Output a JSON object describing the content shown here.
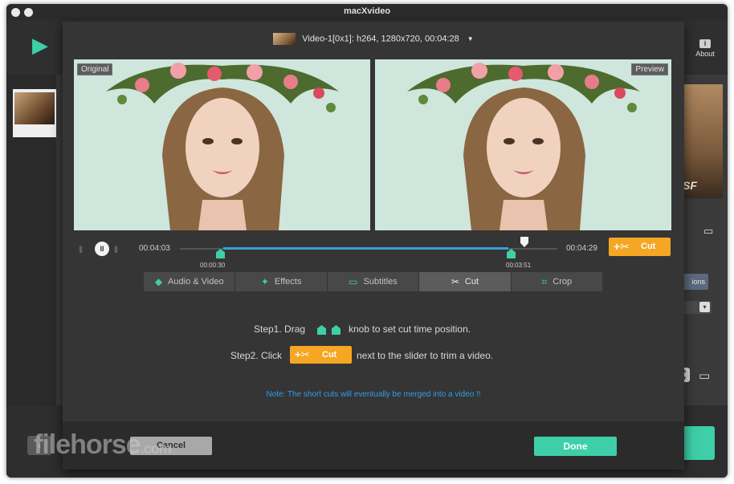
{
  "window": {
    "title": "macXvideo"
  },
  "background_app": {
    "about_label": "About",
    "options_label": "ions",
    "right_thumb_text": "SF"
  },
  "dialog": {
    "video_info": "Video-1[0x1]: h264, 1280x720, 00:04:28",
    "original_label": "Original",
    "preview_label": "Preview",
    "timeline": {
      "current_time": "00:04:03",
      "end_time": "00:04:29",
      "start_knob_time": "00:00:30",
      "end_knob_time": "00:03:51",
      "pause_glyph": "II",
      "start_knob_value": "00:00:30",
      "end_knob_value": "00:03:51",
      "playhead_value": "00:04:03"
    },
    "cut_button_label": "Cut",
    "tabs": [
      {
        "label": "Audio & Video",
        "icon": "audio-video-icon",
        "glyph": "◆"
      },
      {
        "label": "Effects",
        "icon": "effects-wand-icon",
        "glyph": "✦"
      },
      {
        "label": "Subtitles",
        "icon": "subtitles-icon",
        "glyph": "▭"
      },
      {
        "label": "Cut",
        "icon": "scissors-icon",
        "glyph": "✂",
        "active": true
      },
      {
        "label": "Crop",
        "icon": "crop-icon",
        "glyph": "⌗"
      }
    ],
    "instructions": {
      "step1_prefix": "Step1. Drag",
      "step1_suffix": "knob to set cut time position.",
      "step2_prefix": "Step2. Click",
      "step2_suffix": "next to the slider to trim a video.",
      "note": "Note: The short cuts will eventually be merged into a video !!"
    },
    "cancel_label": "Cancel",
    "done_label": "Done"
  },
  "watermark": {
    "text": "filehorse",
    "suffix": ".com"
  },
  "colors": {
    "accent": "#3ecfa8",
    "cut": "#f5a623",
    "note": "#2f9ee8",
    "selection": "#3a9fd8"
  }
}
